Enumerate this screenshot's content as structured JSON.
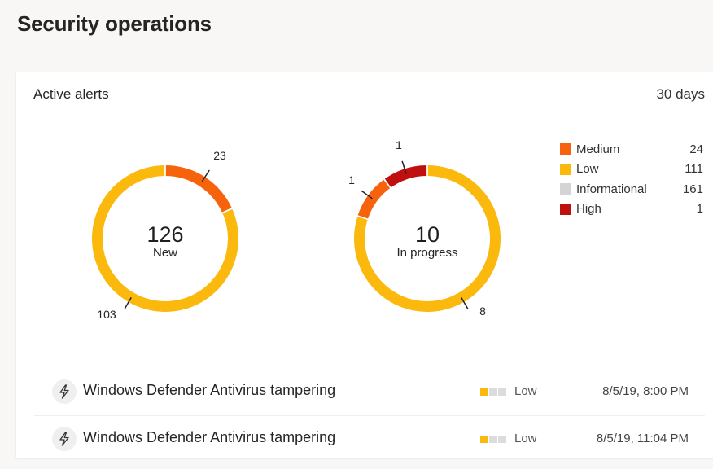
{
  "page": {
    "title": "Security operations"
  },
  "card": {
    "title": "Active alerts",
    "range": "30 days"
  },
  "colors": {
    "medium": "#f7630c",
    "low": "#fbb90d",
    "informational": "#d4d4d4",
    "high": "#c00f0f"
  },
  "chart_data": [
    {
      "type": "pie",
      "variant": "donut",
      "center_value": "126",
      "center_label": "New",
      "slices": [
        {
          "name": "Medium",
          "value": 23,
          "color_key": "medium",
          "label": "23"
        },
        {
          "name": "Low",
          "value": 103,
          "color_key": "low",
          "label": "103"
        }
      ]
    },
    {
      "type": "pie",
      "variant": "donut",
      "center_value": "10",
      "center_label": "In progress",
      "slices": [
        {
          "name": "Low",
          "value": 8,
          "color_key": "low",
          "label": "8"
        },
        {
          "name": "Medium",
          "value": 1,
          "color_key": "medium",
          "label": "1"
        },
        {
          "name": "High",
          "value": 1,
          "color_key": "high",
          "label": "1"
        }
      ]
    }
  ],
  "legend": [
    {
      "label": "Medium",
      "value": "24",
      "color_key": "medium"
    },
    {
      "label": "Low",
      "value": "111",
      "color_key": "low"
    },
    {
      "label": "Informational",
      "value": "161",
      "color_key": "informational"
    },
    {
      "label": "High",
      "value": "1",
      "color_key": "high"
    }
  ],
  "alerts": [
    {
      "icon": "lightning-icon",
      "title": "Windows Defender Antivirus tampering",
      "severity": "Low",
      "severity_level": 1,
      "severity_max": 3,
      "time": "8/5/19, 8:00 PM"
    },
    {
      "icon": "lightning-icon",
      "title": "Windows Defender Antivirus tampering",
      "severity": "Low",
      "severity_level": 1,
      "severity_max": 3,
      "time": "8/5/19, 11:04 PM"
    }
  ]
}
